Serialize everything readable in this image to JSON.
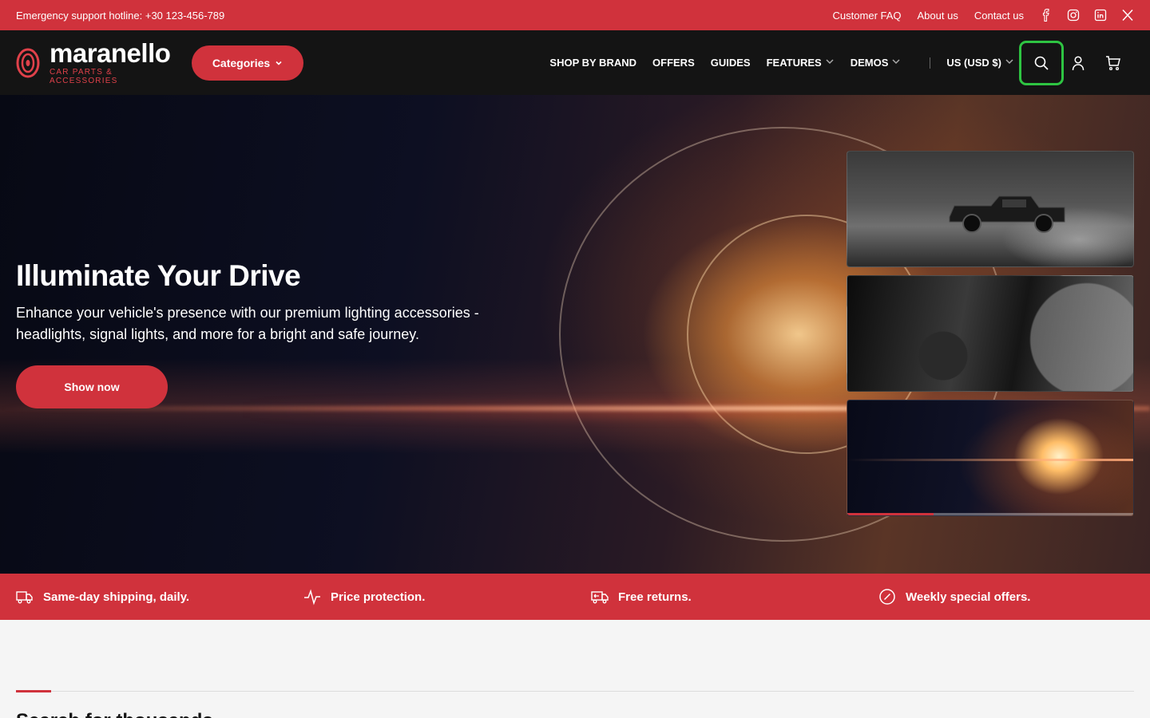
{
  "topbar": {
    "hotline": "Emergency support hotline: +30 123-456-789",
    "links": [
      "Customer FAQ",
      "About us",
      "Contact us"
    ],
    "social_icons": [
      "facebook-icon",
      "instagram-icon",
      "linkedin-icon",
      "x-twitter-icon"
    ]
  },
  "header": {
    "logo_name": "maranello",
    "logo_tagline": "CAR PARTS & ACCESSORIES",
    "categories_label": "Categories",
    "nav": {
      "shop_by_brand": "SHOP BY BRAND",
      "offers": "OFFERS",
      "guides": "GUIDES",
      "features": "FEATURES",
      "demos": "DEMOS"
    },
    "currency": "US (USD $)",
    "icons": [
      "search-icon",
      "user-icon",
      "cart-icon"
    ]
  },
  "hero": {
    "title": "Illuminate Your Drive",
    "subtitle": "Enhance your vehicle's presence with our premium lighting accessories - headlights, signal lights, and more for a bright and safe journey.",
    "cta": "Show now",
    "slide_progress": 0.3
  },
  "features": {
    "shipping": "Same-day shipping, daily.",
    "price": "Price protection.",
    "returns": "Free returns.",
    "offers": "Weekly special offers."
  },
  "section": {
    "heading": "Search for thousands"
  },
  "colors": {
    "brand_red": "#d0323c",
    "header_bg": "#141414",
    "focus_green": "#2ec442"
  }
}
